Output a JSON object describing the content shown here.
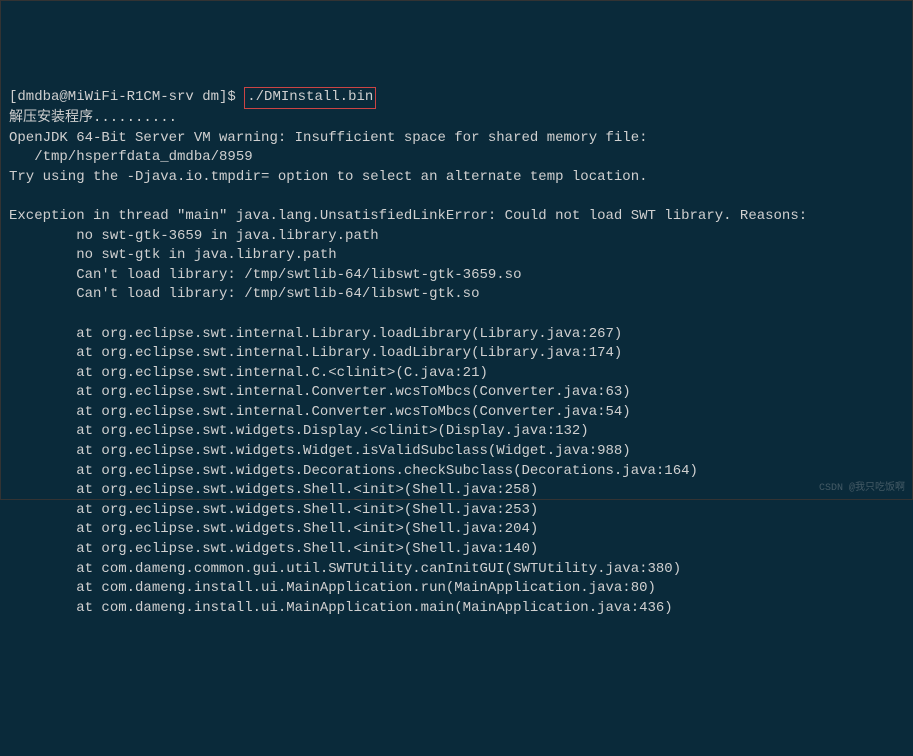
{
  "prompt": {
    "text": "[dmdba@MiWiFi-R1CM-srv dm]$ ",
    "command": "./DMInstall.bin"
  },
  "lines": {
    "l1": "解压安装程序..........",
    "l2": "OpenJDK 64-Bit Server VM warning: Insufficient space for shared memory file:",
    "l3": "   /tmp/hsperfdata_dmdba/8959",
    "l4": "Try using the -Djava.io.tmpdir= option to select an alternate temp location.",
    "l5": "",
    "l6": "Exception in thread \"main\" java.lang.UnsatisfiedLinkError: Could not load SWT library. Reasons:",
    "l7": "        no swt-gtk-3659 in java.library.path",
    "l8": "        no swt-gtk in java.library.path",
    "l9": "        Can't load library: /tmp/swtlib-64/libswt-gtk-3659.so",
    "l10": "        Can't load library: /tmp/swtlib-64/libswt-gtk.so",
    "l11": "",
    "l12": "        at org.eclipse.swt.internal.Library.loadLibrary(Library.java:267)",
    "l13": "        at org.eclipse.swt.internal.Library.loadLibrary(Library.java:174)",
    "l14": "        at org.eclipse.swt.internal.C.<clinit>(C.java:21)",
    "l15": "        at org.eclipse.swt.internal.Converter.wcsToMbcs(Converter.java:63)",
    "l16": "        at org.eclipse.swt.internal.Converter.wcsToMbcs(Converter.java:54)",
    "l17": "        at org.eclipse.swt.widgets.Display.<clinit>(Display.java:132)",
    "l18": "        at org.eclipse.swt.widgets.Widget.isValidSubclass(Widget.java:988)",
    "l19": "        at org.eclipse.swt.widgets.Decorations.checkSubclass(Decorations.java:164)",
    "l20": "        at org.eclipse.swt.widgets.Shell.<init>(Shell.java:258)",
    "l21": "        at org.eclipse.swt.widgets.Shell.<init>(Shell.java:253)",
    "l22": "        at org.eclipse.swt.widgets.Shell.<init>(Shell.java:204)",
    "l23": "        at org.eclipse.swt.widgets.Shell.<init>(Shell.java:140)",
    "l24": "        at com.dameng.common.gui.util.SWTUtility.canInitGUI(SWTUtility.java:380)",
    "l25": "        at com.dameng.install.ui.MainApplication.run(MainApplication.java:80)",
    "l26": "        at com.dameng.install.ui.MainApplication.main(MainApplication.java:436)"
  },
  "watermark": "CSDN @我只吃饭啊"
}
